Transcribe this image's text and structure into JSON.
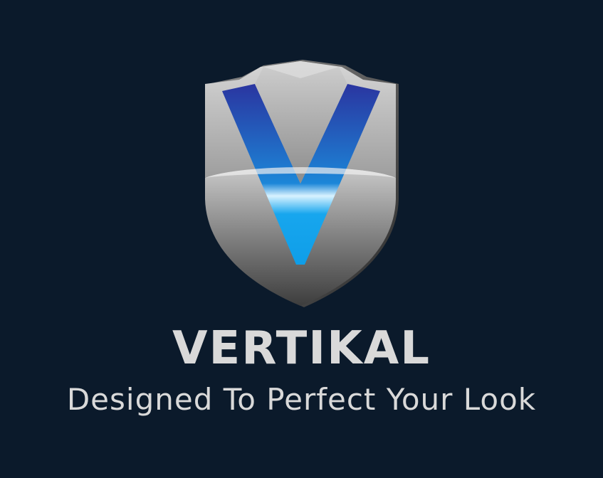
{
  "logo": {
    "brand_name": "VERTIKAL",
    "tagline": "Designed To Perfect Your Look",
    "emblem_icon": "shield-v-emblem-icon"
  },
  "colors": {
    "background": "#0b1a2b",
    "text": "#d9d9d9",
    "shield_light": "#c8c8c8",
    "shield_dark": "#4a4a4a",
    "v_dark_blue": "#2b3a9a",
    "v_light_blue": "#1fa8ee"
  }
}
